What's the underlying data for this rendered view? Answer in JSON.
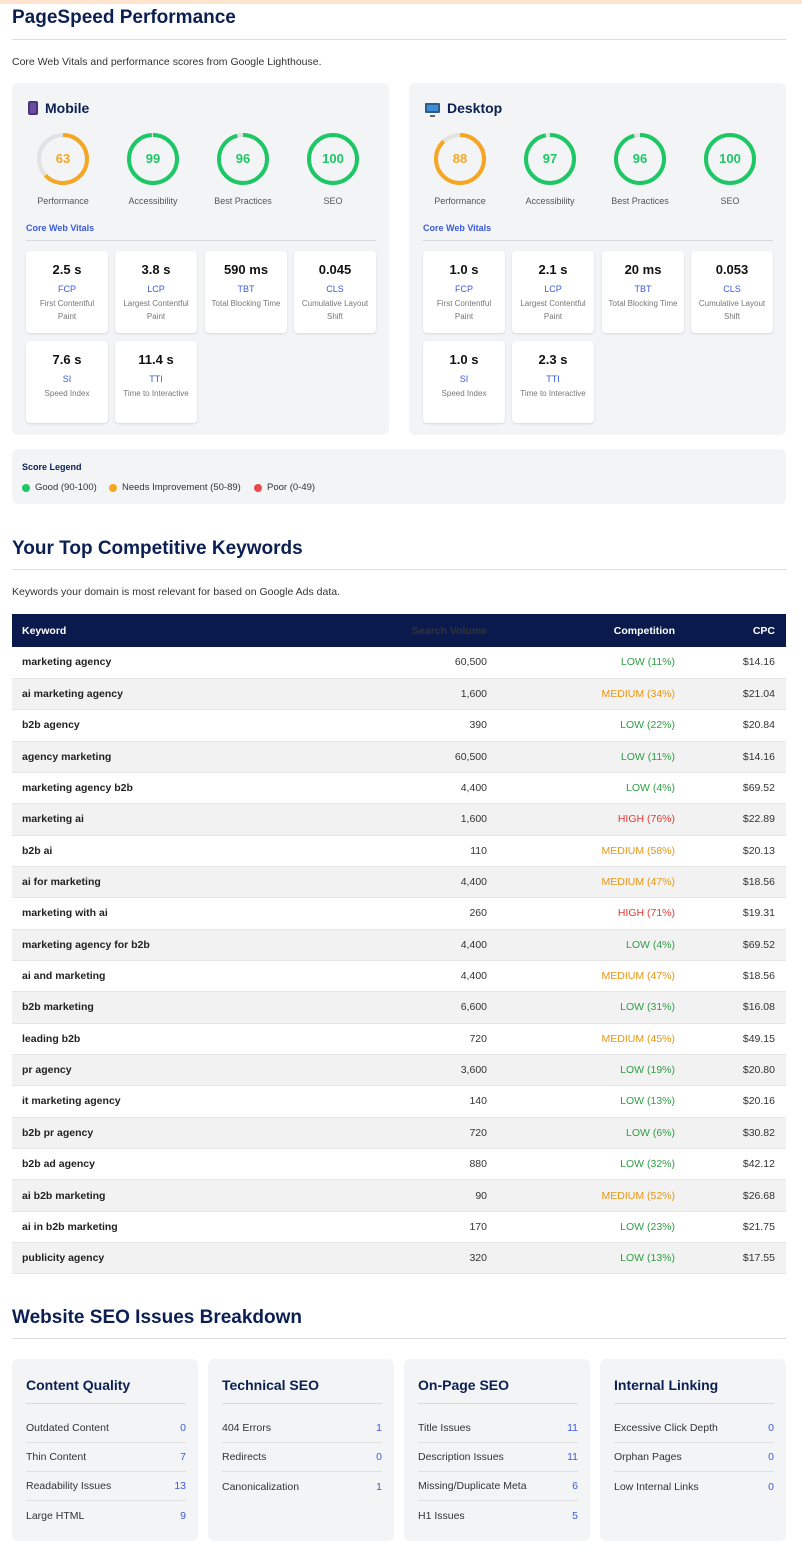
{
  "pagespeed": {
    "title": "PageSpeed Performance",
    "subtitle": "Core Web Vitals and performance scores from Google Lighthouse.",
    "cwv_title": "Core Web Vitals",
    "mobile": {
      "label": "Mobile",
      "icon": "mobile-phone-icon",
      "scores": [
        {
          "value": 63,
          "label": "Performance",
          "color": "#f5a623"
        },
        {
          "value": 99,
          "label": "Accessibility",
          "color": "#1ec765"
        },
        {
          "value": 96,
          "label": "Best Practices",
          "color": "#1ec765"
        },
        {
          "value": 100,
          "label": "SEO",
          "color": "#1ec765"
        }
      ],
      "metrics": [
        {
          "value": "2.5 s",
          "abbr": "FCP",
          "desc": "First Contentful Paint"
        },
        {
          "value": "3.8 s",
          "abbr": "LCP",
          "desc": "Largest Contentful Paint"
        },
        {
          "value": "590 ms",
          "abbr": "TBT",
          "desc": "Total Blocking Time"
        },
        {
          "value": "0.045",
          "abbr": "CLS",
          "desc": "Cumulative Layout Shift"
        },
        {
          "value": "7.6 s",
          "abbr": "SI",
          "desc": "Speed Index"
        },
        {
          "value": "11.4 s",
          "abbr": "TTI",
          "desc": "Time to Interactive"
        }
      ]
    },
    "desktop": {
      "label": "Desktop",
      "icon": "desktop-monitor-icon",
      "scores": [
        {
          "value": 88,
          "label": "Performance",
          "color": "#f5a623"
        },
        {
          "value": 97,
          "label": "Accessibility",
          "color": "#1ec765"
        },
        {
          "value": 96,
          "label": "Best Practices",
          "color": "#1ec765"
        },
        {
          "value": 100,
          "label": "SEO",
          "color": "#1ec765"
        }
      ],
      "metrics": [
        {
          "value": "1.0 s",
          "abbr": "FCP",
          "desc": "First Contentful Paint"
        },
        {
          "value": "2.1 s",
          "abbr": "LCP",
          "desc": "Largest Contentful Paint"
        },
        {
          "value": "20 ms",
          "abbr": "TBT",
          "desc": "Total Blocking Time"
        },
        {
          "value": "0.053",
          "abbr": "CLS",
          "desc": "Cumulative Layout Shift"
        },
        {
          "value": "1.0 s",
          "abbr": "SI",
          "desc": "Speed Index"
        },
        {
          "value": "2.3 s",
          "abbr": "TTI",
          "desc": "Time to Interactive"
        }
      ]
    },
    "legend": {
      "title": "Score Legend",
      "items": [
        {
          "label": "Good (90-100)",
          "color": "#1ec765"
        },
        {
          "label": "Needs Improvement (50-89)",
          "color": "#f5a623"
        },
        {
          "label": "Poor (0-49)",
          "color": "#e84a4a"
        }
      ]
    }
  },
  "keywords": {
    "title": "Your Top Competitive Keywords",
    "subtitle": "Keywords your domain is most relevant for based on Google Ads data.",
    "headers": [
      "Keyword",
      "Search Volume",
      "Competition",
      "CPC"
    ],
    "rows": [
      {
        "keyword": "marketing agency",
        "volume": "60,500",
        "competition": "LOW (11%)",
        "level": "low",
        "cpc": "$14.16"
      },
      {
        "keyword": "ai marketing agency",
        "volume": "1,600",
        "competition": "MEDIUM (34%)",
        "level": "medium",
        "cpc": "$21.04"
      },
      {
        "keyword": "b2b agency",
        "volume": "390",
        "competition": "LOW (22%)",
        "level": "low",
        "cpc": "$20.84"
      },
      {
        "keyword": "agency marketing",
        "volume": "60,500",
        "competition": "LOW (11%)",
        "level": "low",
        "cpc": "$14.16"
      },
      {
        "keyword": "marketing agency b2b",
        "volume": "4,400",
        "competition": "LOW (4%)",
        "level": "low",
        "cpc": "$69.52"
      },
      {
        "keyword": "marketing ai",
        "volume": "1,600",
        "competition": "HIGH (76%)",
        "level": "high",
        "cpc": "$22.89"
      },
      {
        "keyword": "b2b ai",
        "volume": "110",
        "competition": "MEDIUM (58%)",
        "level": "medium",
        "cpc": "$20.13"
      },
      {
        "keyword": "ai for marketing",
        "volume": "4,400",
        "competition": "MEDIUM (47%)",
        "level": "medium",
        "cpc": "$18.56"
      },
      {
        "keyword": "marketing with ai",
        "volume": "260",
        "competition": "HIGH (71%)",
        "level": "high",
        "cpc": "$19.31"
      },
      {
        "keyword": "marketing agency for b2b",
        "volume": "4,400",
        "competition": "LOW (4%)",
        "level": "low",
        "cpc": "$69.52"
      },
      {
        "keyword": "ai and marketing",
        "volume": "4,400",
        "competition": "MEDIUM (47%)",
        "level": "medium",
        "cpc": "$18.56"
      },
      {
        "keyword": "b2b marketing",
        "volume": "6,600",
        "competition": "LOW (31%)",
        "level": "low",
        "cpc": "$16.08"
      },
      {
        "keyword": "leading b2b",
        "volume": "720",
        "competition": "MEDIUM (45%)",
        "level": "medium",
        "cpc": "$49.15"
      },
      {
        "keyword": "pr agency",
        "volume": "3,600",
        "competition": "LOW (19%)",
        "level": "low",
        "cpc": "$20.80"
      },
      {
        "keyword": "it marketing agency",
        "volume": "140",
        "competition": "LOW (13%)",
        "level": "low",
        "cpc": "$20.16"
      },
      {
        "keyword": "b2b pr agency",
        "volume": "720",
        "competition": "LOW (6%)",
        "level": "low",
        "cpc": "$30.82"
      },
      {
        "keyword": "b2b ad agency",
        "volume": "880",
        "competition": "LOW (32%)",
        "level": "low",
        "cpc": "$42.12"
      },
      {
        "keyword": "ai b2b marketing",
        "volume": "90",
        "competition": "MEDIUM (52%)",
        "level": "medium",
        "cpc": "$26.68"
      },
      {
        "keyword": "ai in b2b marketing",
        "volume": "170",
        "competition": "LOW (23%)",
        "level": "low",
        "cpc": "$21.75"
      },
      {
        "keyword": "publicity agency",
        "volume": "320",
        "competition": "LOW (13%)",
        "level": "low",
        "cpc": "$17.55"
      }
    ]
  },
  "seo_issues": {
    "title": "Website SEO Issues Breakdown",
    "cards": [
      {
        "title": "Content Quality",
        "items": [
          {
            "label": "Outdated Content",
            "count": "0"
          },
          {
            "label": "Thin Content",
            "count": "7"
          },
          {
            "label": "Readability Issues",
            "count": "13"
          },
          {
            "label": "Large HTML",
            "count": "9"
          }
        ]
      },
      {
        "title": "Technical SEO",
        "items": [
          {
            "label": "404 Errors",
            "count": "1"
          },
          {
            "label": "Redirects",
            "count": "0"
          },
          {
            "label": "Canonicalization",
            "count": "1"
          }
        ]
      },
      {
        "title": "On-Page SEO",
        "items": [
          {
            "label": "Title Issues",
            "count": "11"
          },
          {
            "label": "Description Issues",
            "count": "11"
          },
          {
            "label": "Missing/Duplicate Meta",
            "count": "6"
          },
          {
            "label": "H1 Issues",
            "count": "5"
          }
        ]
      },
      {
        "title": "Internal Linking",
        "items": [
          {
            "label": "Excessive Click Depth",
            "count": "0"
          },
          {
            "label": "Orphan Pages",
            "count": "0"
          },
          {
            "label": "Low Internal Links",
            "count": "0"
          }
        ]
      }
    ]
  }
}
